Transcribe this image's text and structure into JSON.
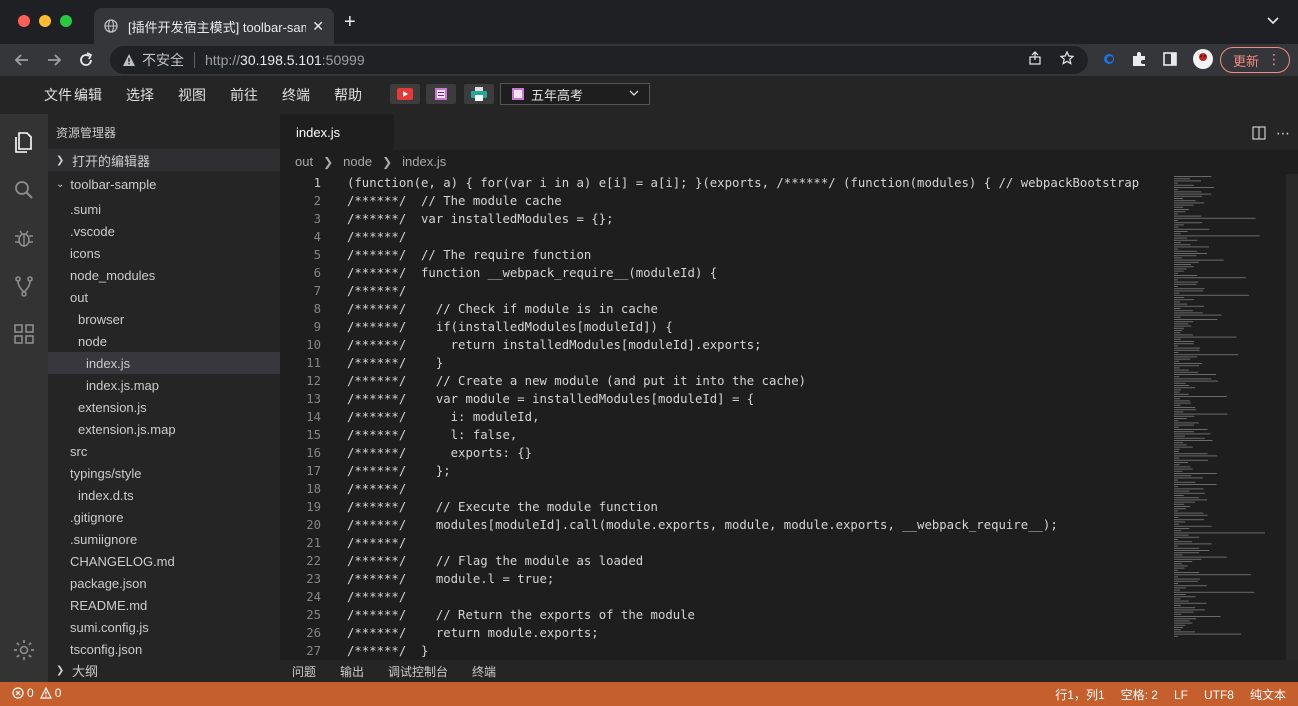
{
  "browser": {
    "tab_title": "[插件开发宿主模式] toolbar-sample",
    "new_tab": "+",
    "insecure_label": "不安全",
    "url_proto": "http://",
    "url_host": "30.198.5.101",
    "url_port": ":50999",
    "update_label": "更新"
  },
  "menu": {
    "items": [
      "文件",
      "编辑",
      "选择",
      "视图",
      "前往",
      "终端",
      "帮助"
    ],
    "select_value": "五年高考"
  },
  "sidebar": {
    "title": "资源管理器",
    "open_editors": "打开的编辑器",
    "root": "toolbar-sample",
    "outline": "大纲",
    "files": [
      {
        "label": ".sumi",
        "indent": 0
      },
      {
        "label": ".vscode",
        "indent": 0
      },
      {
        "label": "icons",
        "indent": 0
      },
      {
        "label": "node_modules",
        "indent": 0
      },
      {
        "label": "out",
        "indent": 0
      },
      {
        "label": "browser",
        "indent": 1
      },
      {
        "label": "node",
        "indent": 1
      },
      {
        "label": "index.js",
        "indent": 2,
        "selected": true
      },
      {
        "label": "index.js.map",
        "indent": 2
      },
      {
        "label": "extension.js",
        "indent": 1
      },
      {
        "label": "extension.js.map",
        "indent": 1
      },
      {
        "label": "src",
        "indent": 0
      },
      {
        "label": "typings/style",
        "indent": 0
      },
      {
        "label": "index.d.ts",
        "indent": 1
      },
      {
        "label": ".gitignore",
        "indent": 0
      },
      {
        "label": ".sumiignore",
        "indent": 0
      },
      {
        "label": "CHANGELOG.md",
        "indent": 0
      },
      {
        "label": "package.json",
        "indent": 0
      },
      {
        "label": "README.md",
        "indent": 0
      },
      {
        "label": "sumi.config.js",
        "indent": 0
      },
      {
        "label": "tsconfig.json",
        "indent": 0
      }
    ]
  },
  "editor": {
    "tab": "index.js",
    "breadcrumb": [
      "out",
      "node",
      "index.js"
    ],
    "lines": [
      "(function(e, a) { for(var i in a) e[i] = a[i]; }(exports, /******/ (function(modules) { // webpackBootstrap",
      "/******/  // The module cache",
      "/******/  var installedModules = {};",
      "/******/",
      "/******/  // The require function",
      "/******/  function __webpack_require__(moduleId) {",
      "/******/",
      "/******/    // Check if module is in cache",
      "/******/    if(installedModules[moduleId]) {",
      "/******/      return installedModules[moduleId].exports;",
      "/******/    }",
      "/******/    // Create a new module (and put it into the cache)",
      "/******/    var module = installedModules[moduleId] = {",
      "/******/      i: moduleId,",
      "/******/      l: false,",
      "/******/      exports: {}",
      "/******/    };",
      "/******/",
      "/******/    // Execute the module function",
      "/******/    modules[moduleId].call(module.exports, module, module.exports, __webpack_require__);",
      "/******/",
      "/******/    // Flag the module as loaded",
      "/******/    module.l = true;",
      "/******/",
      "/******/    // Return the exports of the module",
      "/******/    return module.exports;",
      "/******/  }"
    ]
  },
  "panel": {
    "tabs": [
      "问题",
      "输出",
      "调试控制台",
      "终端"
    ]
  },
  "status": {
    "errors": "0",
    "warnings": "0",
    "position": "行1，列1",
    "indent": "空格: 2",
    "eol": "LF",
    "encoding": "UTF8",
    "language": "纯文本"
  },
  "colors": {
    "statusbar": "#c55f2d",
    "activity": "#333333",
    "sidebar": "#252526",
    "editor": "#1e1e1e"
  }
}
